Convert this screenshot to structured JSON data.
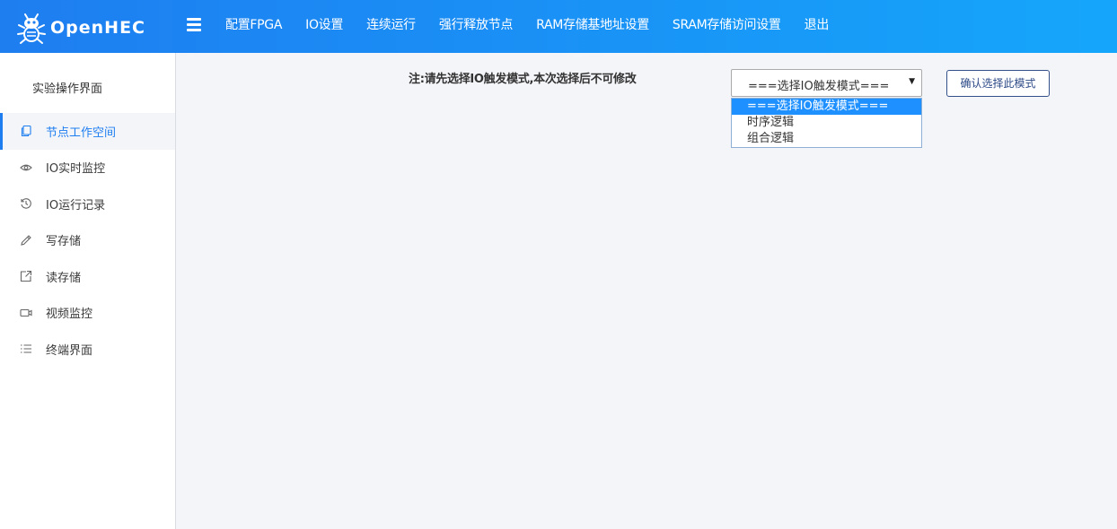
{
  "app": {
    "logo_text": "OpenHEC"
  },
  "nav": {
    "items": [
      "配置FPGA",
      "IO设置",
      "连续运行",
      "强行释放节点",
      "RAM存储基地址设置",
      "SRAM存储访问设置",
      "退出"
    ]
  },
  "sidebar": {
    "header": "实验操作界面",
    "items": [
      {
        "label": "节点工作空间",
        "icon": "copy-icon",
        "active": true
      },
      {
        "label": "IO实时监控",
        "icon": "eye-icon",
        "active": false
      },
      {
        "label": "IO运行记录",
        "icon": "history-icon",
        "active": false
      },
      {
        "label": "写存储",
        "icon": "pencil-icon",
        "active": false
      },
      {
        "label": "读存储",
        "icon": "share-icon",
        "active": false
      },
      {
        "label": "视频监控",
        "icon": "video-icon",
        "active": false
      },
      {
        "label": "终端界面",
        "icon": "list-icon",
        "active": false
      }
    ]
  },
  "main": {
    "notice": "注:请先选择IO触发模式,本次选择后不可修改",
    "select": {
      "value": "===选择IO触发模式===",
      "options": [
        "===选择IO触发模式===",
        "时序逻辑",
        "组合逻辑"
      ],
      "highlighted_index": 0
    },
    "confirm_label": "确认选择此模式"
  },
  "colors": {
    "accent": "#1e7ef0",
    "topbar_end": "#15a6fb",
    "background": "#f4f5f9",
    "highlight": "#1e90ff"
  }
}
